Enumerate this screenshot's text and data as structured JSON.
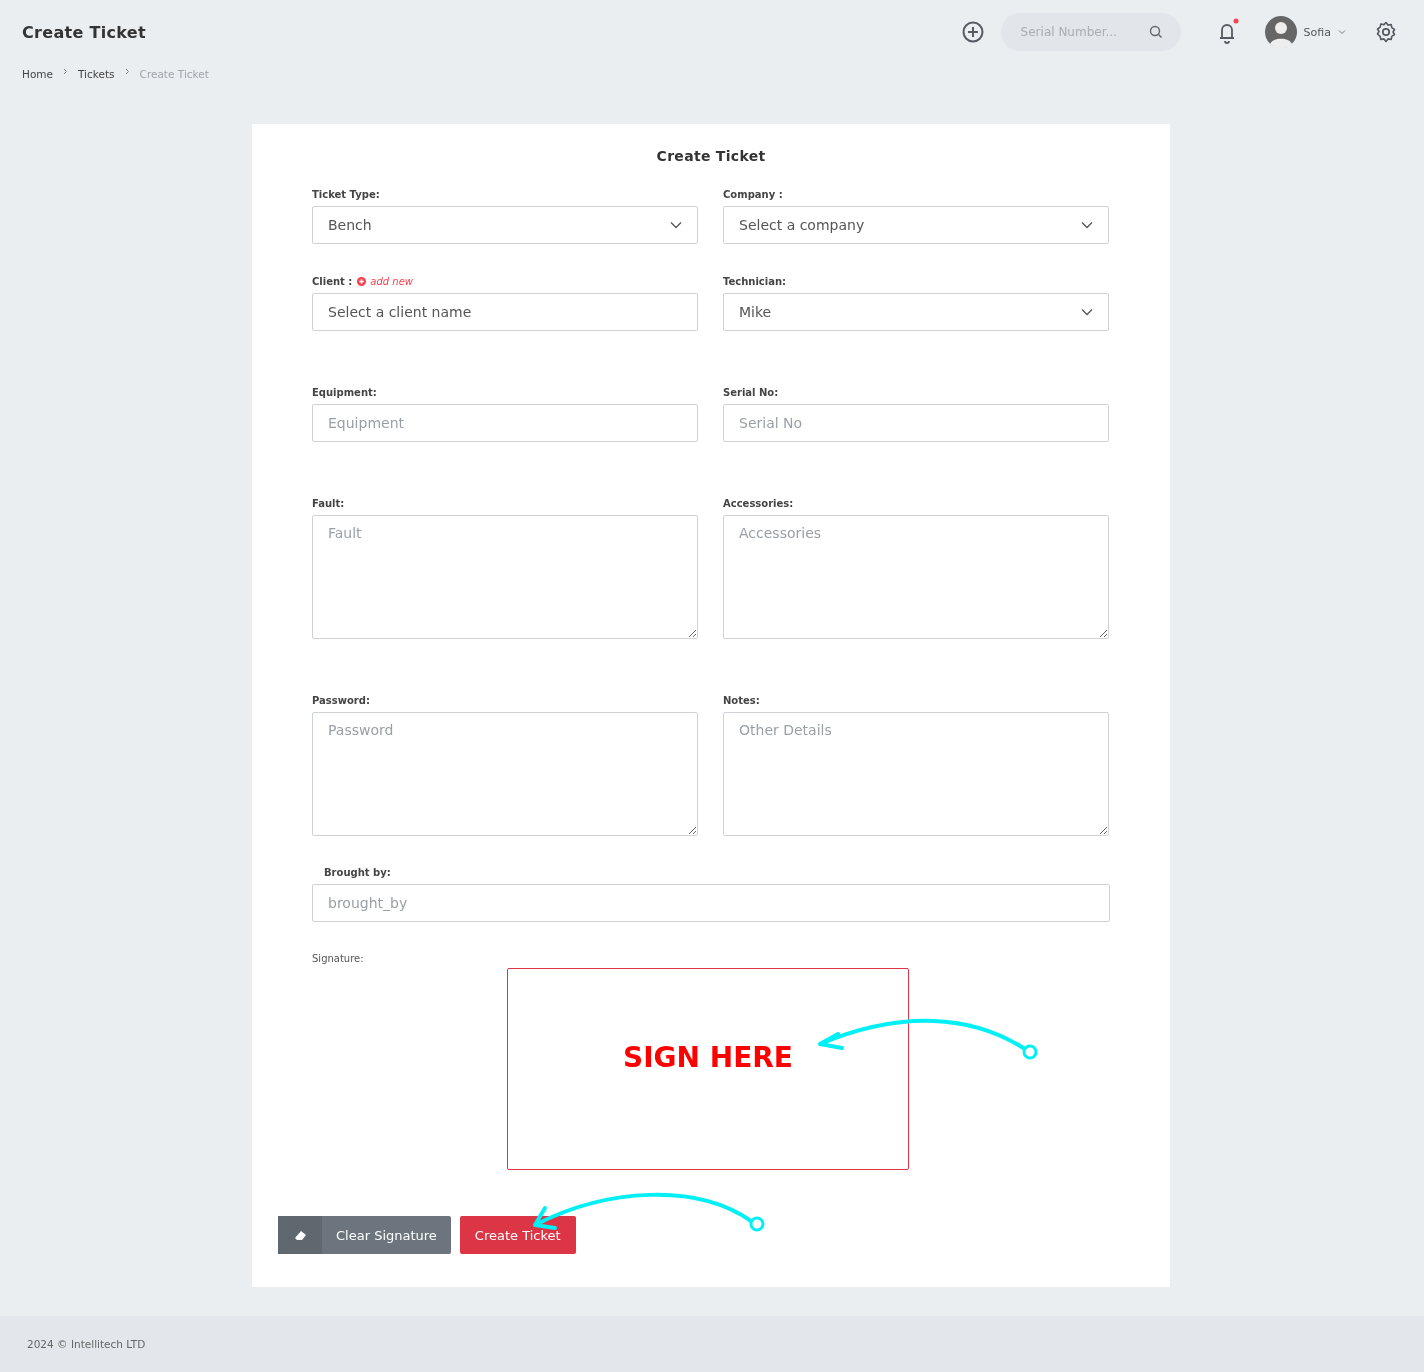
{
  "header": {
    "title": "Create Ticket",
    "search": {
      "placeholder": "Serial Number..."
    },
    "user": {
      "name": "Sofia"
    }
  },
  "breadcrumb": [
    {
      "label": "Home",
      "current": false
    },
    {
      "label": "Tickets",
      "current": false
    },
    {
      "label": "Create Ticket",
      "current": true
    }
  ],
  "form": {
    "title": "Create Ticket",
    "rows": [
      [
        {
          "label": "Ticket Type:",
          "kind": "select",
          "value": "Bench"
        },
        {
          "label": "Company :",
          "kind": "select",
          "value": "Select a company"
        }
      ],
      [
        {
          "label": "Client :",
          "link": "add new",
          "kind": "input",
          "value": "Select a client name"
        },
        {
          "label": "Technician:",
          "kind": "select",
          "value": "Mike"
        }
      ],
      [
        {
          "label": "Equipment:",
          "kind": "input",
          "placeholder": "Equipment"
        },
        {
          "label": "Serial No:",
          "kind": "input",
          "placeholder": "Serial No"
        }
      ],
      [
        {
          "label": "Fault:",
          "kind": "textarea",
          "placeholder": "Fault"
        },
        {
          "label": "Accessories:",
          "kind": "textarea",
          "placeholder": "Accessories"
        }
      ],
      [
        {
          "label": "Password:",
          "kind": "textarea",
          "placeholder": "Password"
        },
        {
          "label": "Notes:",
          "kind": "textarea",
          "placeholder": "Other Details"
        }
      ]
    ],
    "brought_by": {
      "label": "Brought by:",
      "placeholder": "brought_by"
    },
    "signature": {
      "label": "Signature:",
      "prompt": "SIGN HERE"
    },
    "buttons": [
      {
        "label": "Clear Signature",
        "kind": "secondary"
      },
      {
        "label": "Create Ticket",
        "kind": "primary"
      }
    ]
  },
  "footer": "2024 © Intellitech LTD"
}
